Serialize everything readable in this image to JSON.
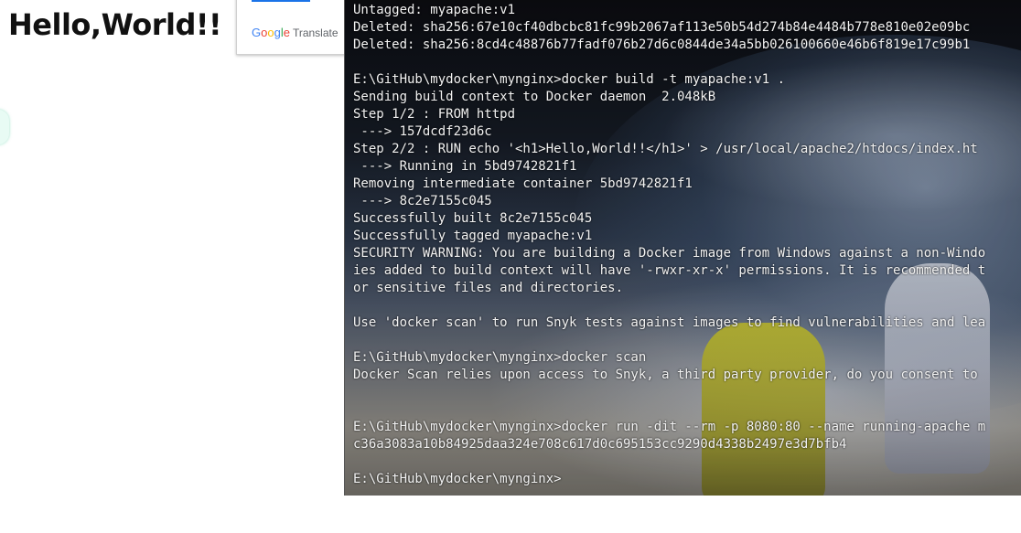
{
  "page": {
    "heading": "Hello,World!!"
  },
  "translate_popup": {
    "brand_letters": [
      "G",
      "o",
      "o",
      "g",
      "l",
      "e"
    ],
    "brand_word": "Translate"
  },
  "terminal": {
    "lines": [
      "Untagged: myapache:v1",
      "Deleted: sha256:67e10cf40dbcbc81fc99b2067af113e50b54d274b84e4484b778e810e02e09bc",
      "Deleted: sha256:8cd4c48876b77fadf076b27d6c0844de34a5bb026100660e46b6f819e17c99b1",
      "",
      "E:\\GitHub\\mydocker\\mynginx>docker build -t myapache:v1 .",
      "Sending build context to Docker daemon  2.048kB",
      "Step 1/2 : FROM httpd",
      " ---> 157dcdf23d6c",
      "Step 2/2 : RUN echo '<h1>Hello,World!!</h1>' > /usr/local/apache2/htdocs/index.ht",
      " ---> Running in 5bd9742821f1",
      "Removing intermediate container 5bd9742821f1",
      " ---> 8c2e7155c045",
      "Successfully built 8c2e7155c045",
      "Successfully tagged myapache:v1",
      "SECURITY WARNING: You are building a Docker image from Windows against a non-Windo",
      "ies added to build context will have '-rwxr-xr-x' permissions. It is recommended t",
      "or sensitive files and directories.",
      "",
      "Use 'docker scan' to run Snyk tests against images to find vulnerabilities and lea",
      "",
      "E:\\GitHub\\mydocker\\mynginx>docker scan",
      "Docker Scan relies upon access to Snyk, a third party provider, do you consent to",
      "",
      "",
      "E:\\GitHub\\mydocker\\mynginx>docker run -dit --rm -p 8080:80 --name running-apache m",
      "c36a3083a10b84925daa324e708c617d0c695153cc9290d4338b2497e3d7bfb4",
      "",
      "E:\\GitHub\\mydocker\\mynginx>"
    ]
  }
}
